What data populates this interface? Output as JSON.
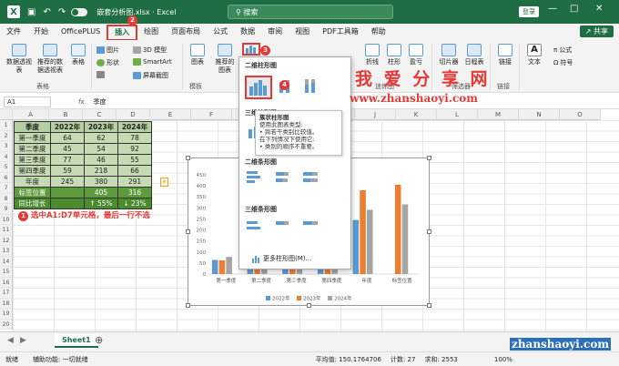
{
  "titlebar": {
    "filename": "嵌套分析图.xlsx",
    "separator": "·",
    "app": "Excel",
    "search": "搜索",
    "login": "登录"
  },
  "menu": [
    "文件",
    "开始",
    "OfficePLUS",
    "插入",
    "绘图",
    "页面布局",
    "公式",
    "数据",
    "审阅",
    "视图",
    "PDF工具箱",
    "帮助"
  ],
  "share": "共享",
  "ribbon": {
    "pivot": "数据透视表",
    "recommended_pivot": "推荐的数据透视表",
    "table": "表格",
    "picture": "图片",
    "shapes": "形状",
    "model3d": "3D 模型",
    "smartart": "SmartArt",
    "screenshot": "屏幕截图",
    "chart": "图表",
    "recommended_chart": "推荐的图表",
    "line": "折线",
    "column": "柱形",
    "winloss": "盈亏",
    "slicer": "切片器",
    "timeline": "日程表",
    "link": "链接",
    "text": "文本",
    "equation": "公式",
    "symbol": "符号",
    "groups": {
      "tables": "表格",
      "templates": "模板",
      "sparklines": "迷你图",
      "filter": "筛选器",
      "links": "链接"
    }
  },
  "formula": {
    "namebox": "A1",
    "fx": "fx",
    "value": "季度"
  },
  "columns": [
    "A",
    "B",
    "C",
    "D",
    "E",
    "F",
    "G",
    "H",
    "I",
    "J",
    "K",
    "L",
    "M",
    "N",
    "O"
  ],
  "rows": [
    "1",
    "2",
    "3",
    "4",
    "5",
    "6",
    "7",
    "8",
    "9",
    "10",
    "11",
    "12",
    "13",
    "14",
    "15",
    "16",
    "17",
    "18",
    "19",
    "20"
  ],
  "table": {
    "header": [
      "季度",
      "2022年",
      "2023年",
      "2024年"
    ],
    "data": [
      [
        "第一季度",
        "64",
        "62",
        "78"
      ],
      [
        "第二季度",
        "45",
        "54",
        "92"
      ],
      [
        "第三季度",
        "77",
        "46",
        "55"
      ],
      [
        "第四季度",
        "59",
        "218",
        "66"
      ],
      [
        "年度",
        "245",
        "380",
        "291"
      ]
    ],
    "target": [
      "标签位置",
      "",
      "405",
      "316"
    ],
    "growth": [
      "同比增长",
      "",
      "↑ 55%",
      "↓ 23%"
    ]
  },
  "note": "选中A1:D7单元格，最后一行不选",
  "note_step": "1",
  "steps": {
    "insert": "2",
    "chart": "3",
    "clustered": "4"
  },
  "dropdown": {
    "sec1": "二维柱形图",
    "sec2": "三维柱形图",
    "sec3": "二维条形图",
    "sec4": "三维条形图",
    "more": "更多柱形图(M)...",
    "tooltip_title": "簇状柱形图",
    "tooltip_lines": [
      "使用此图表类型:",
      "• 跨若干类别比较值。",
      "在下列情况下使用它:",
      "• 类别的顺序不重要。"
    ]
  },
  "watermark": {
    "cn": "我 爱 分 享 网",
    "url": "www.zhanshaoyi.com",
    "url2": "zhanshaoyi.com"
  },
  "sheet_tab": "Sheet1",
  "status": {
    "ready": "就绪",
    "accessibility": "辅助功能: 一切就绪",
    "average": "平均值: 150.1764706",
    "count": "计数: 27",
    "sum": "求和: 2553",
    "zoom": "100%"
  },
  "colors": {
    "excel_green": "#1f6e43",
    "series2022": "#5b9bd5",
    "series2023": "#ed7d31",
    "series2024": "#a5a5a5",
    "annotation_red": "#e53935"
  },
  "chart_data": {
    "type": "bar",
    "categories": [
      "第一季度",
      "第二季度",
      "第三季度",
      "第四季度",
      "年度",
      "标签位置"
    ],
    "series": [
      {
        "name": "2022年",
        "values": [
          64,
          45,
          77,
          59,
          245,
          0
        ]
      },
      {
        "name": "2023年",
        "values": [
          62,
          54,
          46,
          218,
          380,
          405
        ]
      },
      {
        "name": "2024年",
        "values": [
          78,
          92,
          55,
          66,
          291,
          316
        ]
      }
    ],
    "yticks": [
      "0",
      "50",
      "100",
      "150",
      "200",
      "250",
      "300",
      "350",
      "400",
      "450"
    ],
    "ylim": [
      0,
      450
    ],
    "legend": "bottom",
    "grid": false
  }
}
